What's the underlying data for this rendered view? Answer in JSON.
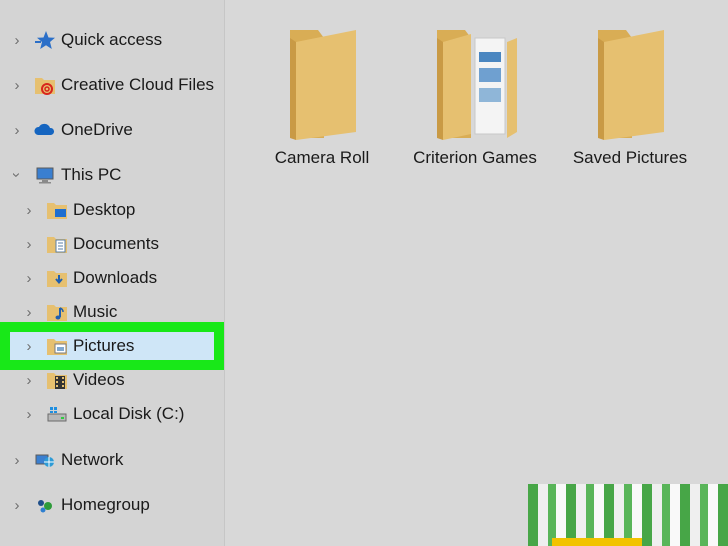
{
  "nav": {
    "items": [
      {
        "label": "Quick access"
      },
      {
        "label": "Creative Cloud Files"
      },
      {
        "label": "OneDrive"
      },
      {
        "label": "This PC"
      },
      {
        "label": "Desktop"
      },
      {
        "label": "Documents"
      },
      {
        "label": "Downloads"
      },
      {
        "label": "Music"
      },
      {
        "label": "Pictures"
      },
      {
        "label": "Videos"
      },
      {
        "label": "Local Disk (C:)"
      },
      {
        "label": "Network"
      },
      {
        "label": "Homegroup"
      }
    ]
  },
  "content": {
    "folders": [
      {
        "label": "Camera Roll"
      },
      {
        "label": "Criterion Games"
      },
      {
        "label": "Saved Pictures"
      }
    ]
  },
  "colors": {
    "highlight": "#18e818",
    "selected_bg": "#cfe6f7",
    "folder": "#e6c070"
  }
}
